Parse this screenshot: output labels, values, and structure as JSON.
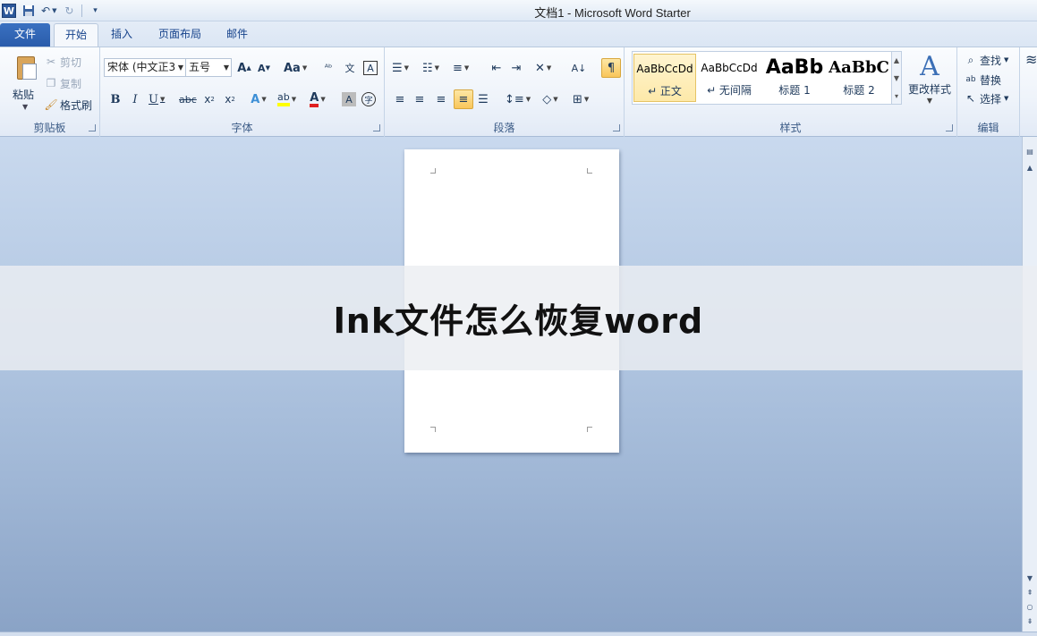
{
  "window": {
    "title": "文档1 - Microsoft Word Starter"
  },
  "qat": {
    "logo": "W"
  },
  "tabs": [
    {
      "label": "文件"
    },
    {
      "label": "开始"
    },
    {
      "label": "插入"
    },
    {
      "label": "页面布局"
    },
    {
      "label": "邮件"
    }
  ],
  "clipboard": {
    "paste_label": "粘贴",
    "cut_label": "剪切",
    "copy_label": "复制",
    "format_painter_label": "格式刷",
    "group_label": "剪贴板"
  },
  "font": {
    "font_name": "宋体 (中文正3",
    "font_size": "五号",
    "group_label": "字体"
  },
  "paragraph": {
    "group_label": "段落"
  },
  "styles": {
    "items": [
      {
        "preview": "AaBbCcDd",
        "name": "↵ 正文"
      },
      {
        "preview": "AaBbCcDd",
        "name": "↵ 无间隔"
      },
      {
        "preview": "AaBb",
        "name": "标题 1"
      },
      {
        "preview": "AaBbC",
        "name": "标题 2"
      }
    ],
    "change_styles_label": "更改样式",
    "group_label": "样式"
  },
  "editing": {
    "find_label": "查找",
    "replace_label": "替换",
    "select_label": "选择",
    "group_label": "编辑"
  },
  "banner": {
    "text": "lnk文件怎么恢复word"
  }
}
